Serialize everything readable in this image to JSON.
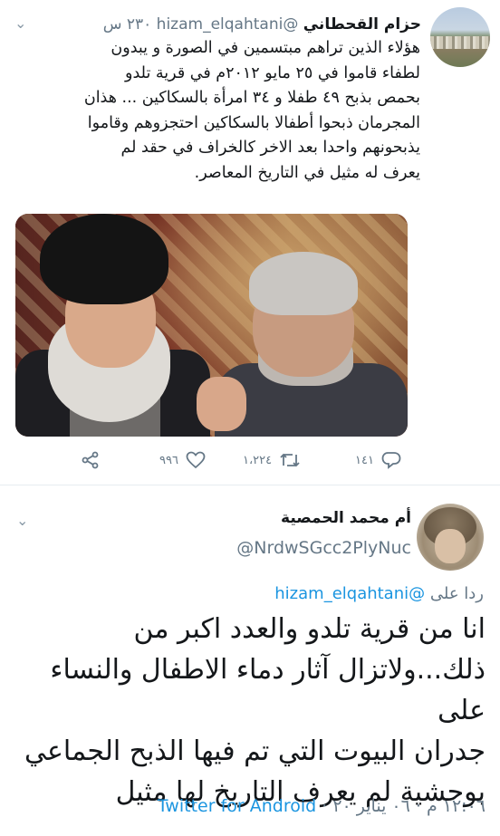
{
  "tweet": {
    "author_name": "حزام القحطاني",
    "handle": "@hizam_elqahtani",
    "time": "٢٣٠ س",
    "lines": [
      "هؤلاء الذين تراهم مبتسمين في الصورة و يبدون",
      "لطفاء قاموا في ٢٥ مايو ٢٠١٢م في قرية تلدو",
      "بحمص بذبح ٤٩ طفلا و ٣٤ امرأة بالسكاكين ... هذان",
      "المجرمان ذبحوا أطفالا بالسكاكين احتجزوهم وقاموا",
      "يذبحونهم واحدا بعد الاخر كالخراف في حقد لم",
      "يعرف له مثيل في التاريخ المعاصر."
    ],
    "actions": {
      "reply_count": "١٤١",
      "retweet_count": "١،٢٢٤",
      "like_count": "٩٩٦"
    }
  },
  "reply": {
    "author_name": "أم محمد الحمصية",
    "handle": "@NrdwSGcc2PlyNuc",
    "replying_prefix": "ردا على",
    "replying_to": "@hizam_elqahtani",
    "lines": [
      "انا من قرية تلدو والعدد اكبر من",
      "ذلك...ولاتزال آثار دماء الاطفال والنساء على",
      "جدران البيوت التي تم فيها الذبح الجماعي",
      "بوحشية لم يعرف التاريخ لها مثيل"
    ],
    "timestamp": "١٢:٠٦ م · ٠٦ يناير ٢٠",
    "source": "Twitter for Android"
  },
  "icons": {
    "reply": "reply-icon",
    "retweet": "retweet-icon",
    "like": "heart-icon",
    "share": "share-icon",
    "menu": "chevron-down-icon"
  }
}
